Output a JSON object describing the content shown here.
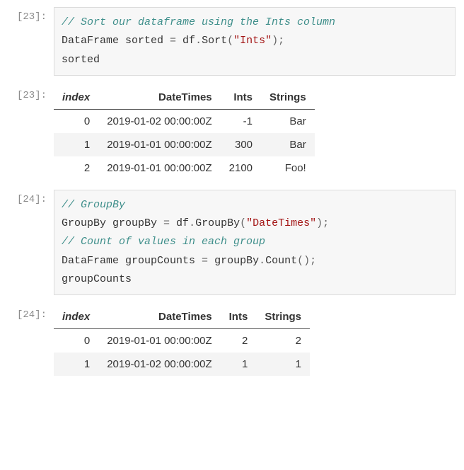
{
  "cells": [
    {
      "prompt": "[23]:",
      "type": "code",
      "code": {
        "lines": [
          [
            {
              "t": "// Sort our dataframe using the Ints column",
              "c": "comment"
            }
          ],
          [
            {
              "t": "DataFrame sorted ",
              "c": ""
            },
            {
              "t": "=",
              "c": "punct"
            },
            {
              "t": " df",
              "c": ""
            },
            {
              "t": ".",
              "c": "punct"
            },
            {
              "t": "Sort",
              "c": ""
            },
            {
              "t": "(",
              "c": "punct"
            },
            {
              "t": "\"Ints\"",
              "c": "string"
            },
            {
              "t": ");",
              "c": "punct"
            }
          ],
          [
            {
              "t": "sorted",
              "c": ""
            }
          ]
        ]
      }
    },
    {
      "prompt": "[23]:",
      "type": "table",
      "table": {
        "headers": [
          "index",
          "DateTimes",
          "Ints",
          "Strings"
        ],
        "rows": [
          [
            "0",
            "2019-01-02 00:00:00Z",
            "-1",
            "Bar"
          ],
          [
            "1",
            "2019-01-01 00:00:00Z",
            "300",
            "Bar"
          ],
          [
            "2",
            "2019-01-01 00:00:00Z",
            "2100",
            "Foo!"
          ]
        ]
      }
    },
    {
      "prompt": "[24]:",
      "type": "code",
      "code": {
        "lines": [
          [
            {
              "t": "// GroupBy",
              "c": "comment"
            }
          ],
          [
            {
              "t": "GroupBy groupBy ",
              "c": ""
            },
            {
              "t": "=",
              "c": "punct"
            },
            {
              "t": " df",
              "c": ""
            },
            {
              "t": ".",
              "c": "punct"
            },
            {
              "t": "GroupBy",
              "c": ""
            },
            {
              "t": "(",
              "c": "punct"
            },
            {
              "t": "\"DateTimes\"",
              "c": "string"
            },
            {
              "t": ");",
              "c": "punct"
            }
          ],
          [
            {
              "t": "// Count of values in each group",
              "c": "comment"
            }
          ],
          [
            {
              "t": "DataFrame groupCounts ",
              "c": ""
            },
            {
              "t": "=",
              "c": "punct"
            },
            {
              "t": " groupBy",
              "c": ""
            },
            {
              "t": ".",
              "c": "punct"
            },
            {
              "t": "Count",
              "c": ""
            },
            {
              "t": "();",
              "c": "punct"
            }
          ],
          [
            {
              "t": "groupCounts",
              "c": ""
            }
          ]
        ]
      }
    },
    {
      "prompt": "[24]:",
      "type": "table",
      "table": {
        "headers": [
          "index",
          "DateTimes",
          "Ints",
          "Strings"
        ],
        "rows": [
          [
            "0",
            "2019-01-01 00:00:00Z",
            "2",
            "2"
          ],
          [
            "1",
            "2019-01-02 00:00:00Z",
            "1",
            "1"
          ]
        ]
      }
    }
  ]
}
